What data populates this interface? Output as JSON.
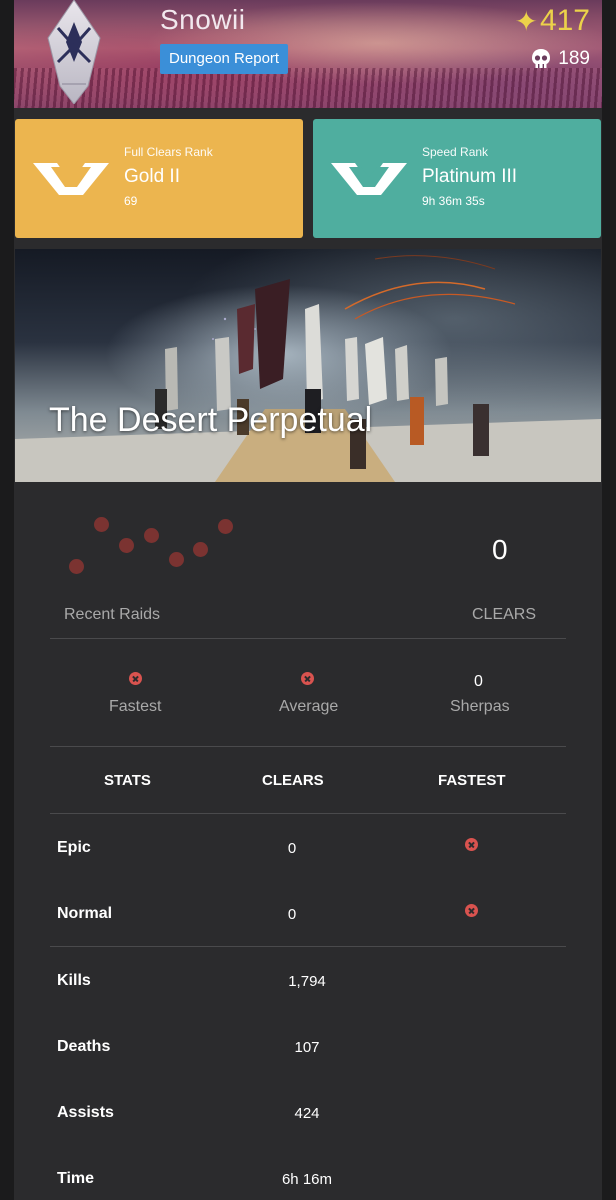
{
  "header": {
    "player_name": "Snowii",
    "report_button": "Dungeon Report",
    "power_icon": "star-glyph",
    "power_level": "417",
    "triumph_icon": "skull-icon",
    "triumph_score": "189",
    "accent": "#3b8fd8"
  },
  "ranks": [
    {
      "label": "Full Clears Rank",
      "tier": "Gold II",
      "value": "69",
      "color": "#ecb54f",
      "icon": "rank-chevron-icon"
    },
    {
      "label": "Speed Rank",
      "tier": "Platinum III",
      "value": "9h 36m 35s",
      "color": "#4fae9f",
      "icon": "rank-chevron-icon"
    }
  ],
  "activity": {
    "name": "The Desert Perpetual"
  },
  "summary": {
    "recent_label": "Recent Raids",
    "clears_value": "0",
    "clears_label": "CLEARS",
    "fastest_label": "Fastest",
    "average_label": "Average",
    "sherpas_value": "0",
    "sherpas_label": "Sherpas",
    "failed_color": "#7b3331"
  },
  "table": {
    "headers": [
      "STATS",
      "CLEARS",
      "FASTEST"
    ],
    "difficulty_rows": [
      {
        "label": "Epic",
        "clears": "0"
      },
      {
        "label": "Normal",
        "clears": "0"
      }
    ],
    "stat_rows": [
      {
        "label": "Kills",
        "value": "1,794"
      },
      {
        "label": "Deaths",
        "value": "107"
      },
      {
        "label": "Assists",
        "value": "424"
      },
      {
        "label": "Time",
        "value": "6h 16m"
      }
    ]
  }
}
